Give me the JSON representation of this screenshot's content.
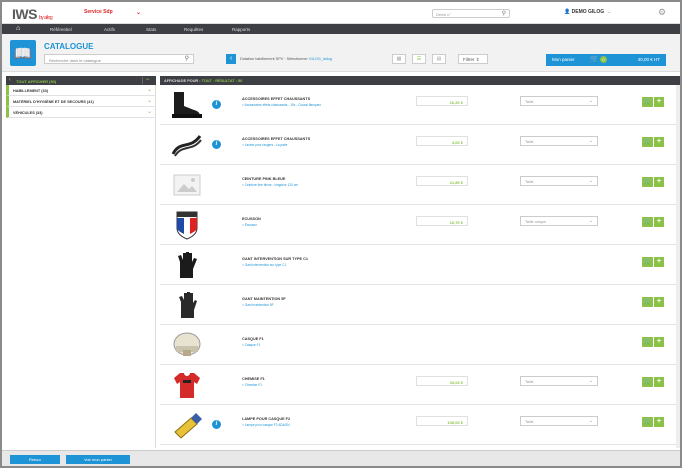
{
  "app": {
    "logo": "IWS",
    "logo_sub": "by ailog",
    "service": "Service Sdp",
    "search_placeholder": "Devis n°",
    "user": "DEMO GILOG",
    "accent": "#1e93d6",
    "green": "#8bc34a"
  },
  "nav": {
    "home_icon": "home-icon",
    "items": [
      "Référentiel",
      "Actifs",
      "Stats",
      "Requêtes",
      "Rapports"
    ]
  },
  "catalogue": {
    "title": "CATALOGUE",
    "search_placeholder": "Recherche dans le catalogue",
    "breadcrumb_prefix": "Dotation habillement SPV · Sélectionner",
    "breadcrumb_link": "GILOG_iailog",
    "filter_label": "Filtrer",
    "cart_label": "Mon panier",
    "cart_count": "0",
    "cart_amount": "40,00 € HT"
  },
  "sidebar": {
    "header": "TOUT AFFICHER (50)",
    "items": [
      "HABILLEMENT (33)",
      "MATÉRIEL D'HYGIÈNE ET DE SECOURS (41)",
      "VÉHICULES (33)"
    ]
  },
  "main": {
    "header_prefix": "AFFICHAGE POUR :",
    "header_highlight": "TOUT · RÉSULTAT : 50"
  },
  "products": [
    {
      "name": "ACCESSOIRES EFFET CHAUSSANTS",
      "sub": "> Accessoires effets chaussants - 19x - Coussi flanqueo",
      "price": "16,20 €",
      "size": "Taille",
      "has_info": true,
      "thumb": "boots"
    },
    {
      "name": "ACCESSOIRES EFFET CHAUSSANTS",
      "sub": "> Lacets pour rangers - La paire",
      "price": "4,00 €",
      "size": "Taille",
      "has_info": true,
      "thumb": "laces"
    },
    {
      "name": "CEINTURE PINK BLEUE",
      "sub": "> Ceinture fine bleue - longueur 120 cm",
      "price": "21,89 €",
      "size": "Taille",
      "has_info": false,
      "thumb": "placeholder"
    },
    {
      "name": "ECUSSON",
      "sub": "> Écusson",
      "price": "16,70 €",
      "size": "Taille unique",
      "has_info": false,
      "thumb": "badge"
    },
    {
      "name": "GANT INTERVENTION SUR TYPE C1",
      "sub": "> Gant intervention sur type C1",
      "price": "",
      "size": "",
      "has_info": false,
      "thumb": "glove"
    },
    {
      "name": "GANT MAINTENTION 5F",
      "sub": "> Gant maintention 5F",
      "price": "",
      "size": "",
      "has_info": false,
      "thumb": "glove2"
    },
    {
      "name": "CASQUE F1",
      "sub": "> Casque F1",
      "price": "",
      "size": "",
      "has_info": false,
      "thumb": "helmet"
    },
    {
      "name": "CHEMISE F1",
      "sub": "> Chemise F1",
      "price": "33,04 €",
      "size": "Taille",
      "has_info": false,
      "thumb": "shirt"
    },
    {
      "name": "LAMPE POUR CASQUE F2",
      "sub": "> Lampe pour casque F2 ADAGN",
      "price": "108,00 €",
      "size": "Taille",
      "has_info": true,
      "thumb": "lamp"
    }
  ],
  "footer": {
    "btn1": "Retour",
    "btn2": "Voir mon panier"
  }
}
